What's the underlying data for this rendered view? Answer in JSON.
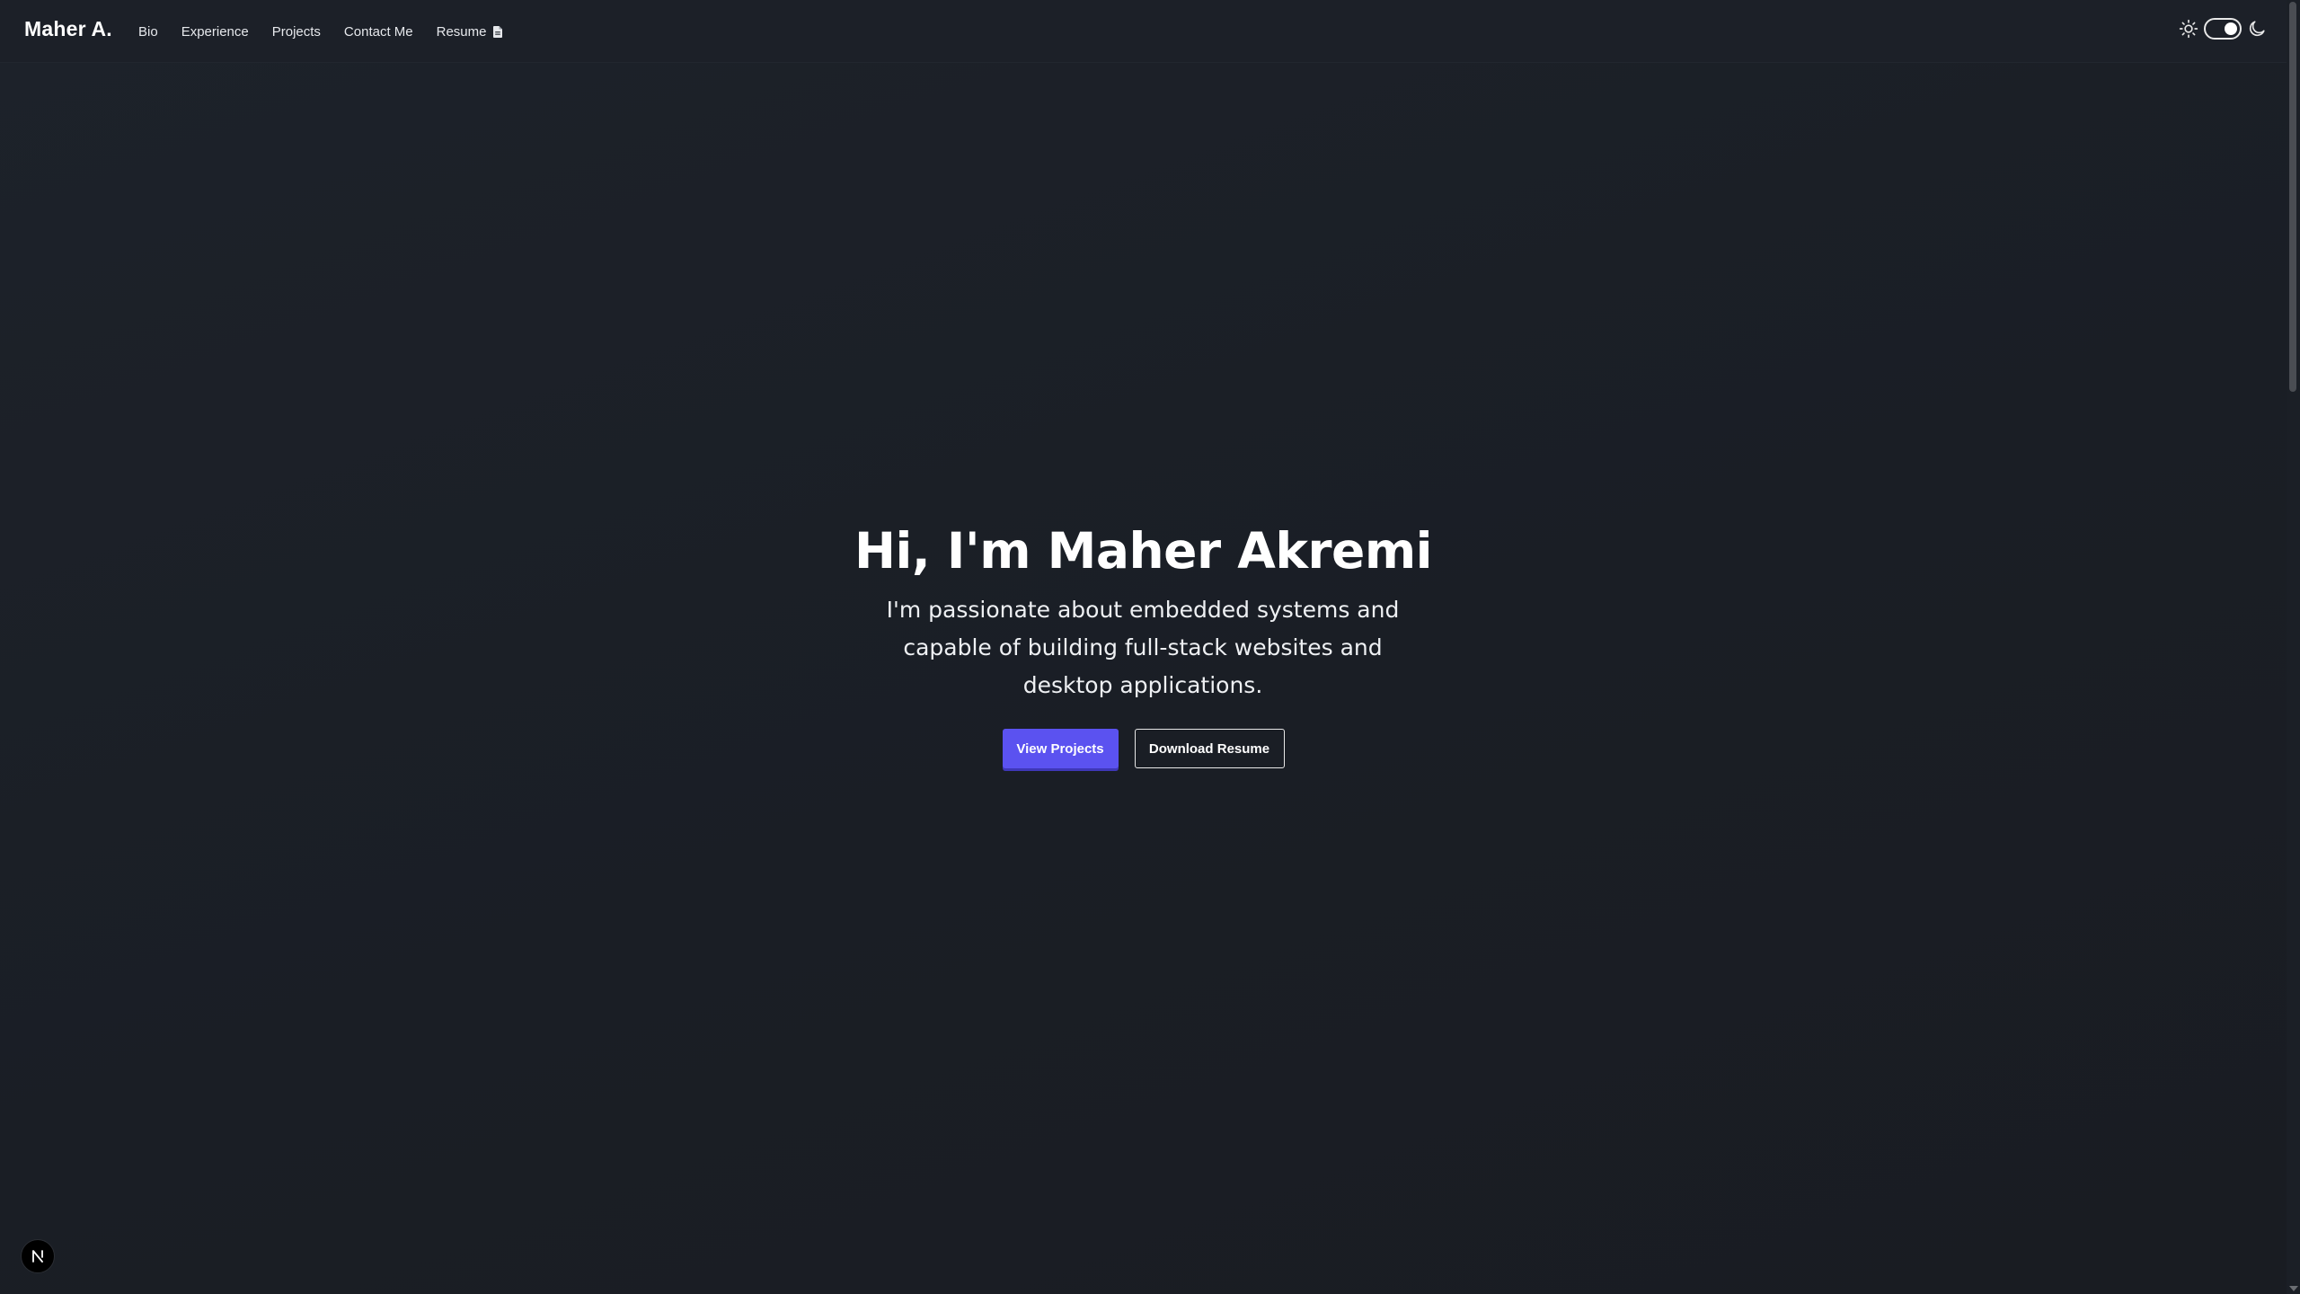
{
  "navbar": {
    "brand": "Maher A.",
    "links": [
      {
        "label": "Bio"
      },
      {
        "label": "Experience"
      },
      {
        "label": "Projects"
      },
      {
        "label": "Contact Me"
      },
      {
        "label": "Resume",
        "icon": "file-icon"
      }
    ],
    "theme_toggle": {
      "left_icon": "sun-icon",
      "right_icon": "moon-icon",
      "state": "dark"
    }
  },
  "hero": {
    "title": "Hi, I'm Maher Akremi",
    "subtitle": "I'm passionate about embedded systems and capable of building full-stack websites and desktop applications.",
    "primary_button": "View Projects",
    "secondary_button": "Download Resume"
  },
  "badge": {
    "icon": "nextjs-n-icon",
    "letter": "N"
  },
  "colors": {
    "background": "#1b1f27",
    "navbar": "#1c2028",
    "accent": "#5b52f0",
    "text": "#ffffff"
  }
}
